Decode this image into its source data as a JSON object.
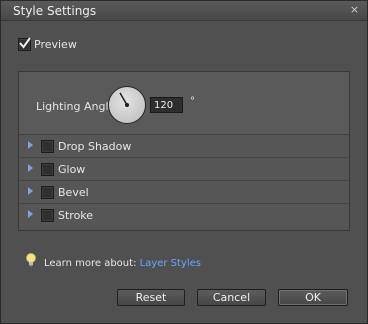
{
  "window": {
    "title": "Style Settings",
    "close_glyph": "×"
  },
  "preview": {
    "label": "Preview",
    "checked": true
  },
  "lighting": {
    "label": "Lighting Angle:",
    "value": "120",
    "unit": "°",
    "angle_degrees": 120
  },
  "styles": [
    {
      "label": "Drop Shadow",
      "checked": false
    },
    {
      "label": "Glow",
      "checked": false
    },
    {
      "label": "Bevel",
      "checked": false
    },
    {
      "label": "Stroke",
      "checked": false
    }
  ],
  "help": {
    "prefix": "Learn more about:",
    "link": "Layer Styles",
    "icon": "lightbulb-icon"
  },
  "buttons": {
    "reset": "Reset",
    "cancel": "Cancel",
    "ok": "OK"
  },
  "colors": {
    "link": "#6ba4ff",
    "expand_triangle": "#7da3e6",
    "bulb": "#f3e48a"
  }
}
